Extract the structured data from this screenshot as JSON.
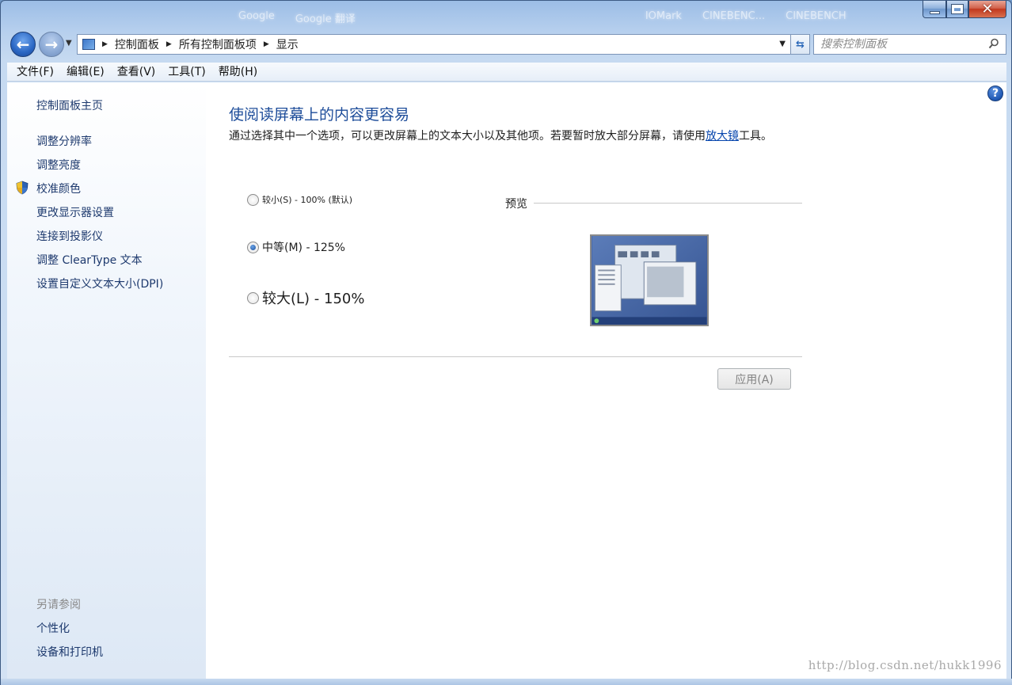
{
  "titlebar": {
    "ghost_tabs": [
      "Google",
      "Google 翻译",
      "IOMark",
      "CINEBENC...",
      "CINEBENCH"
    ]
  },
  "nav": {
    "breadcrumbs": [
      "控制面板",
      "所有控制面板项",
      "显示"
    ],
    "search_placeholder": "搜索控制面板"
  },
  "menu": {
    "items": [
      "文件(F)",
      "编辑(E)",
      "查看(V)",
      "工具(T)",
      "帮助(H)"
    ]
  },
  "sidebar": {
    "home": "控制面板主页",
    "links": [
      "调整分辨率",
      "调整亮度",
      "校准颜色",
      "更改显示器设置",
      "连接到投影仪",
      "调整 ClearType 文本",
      "设置自定义文本大小(DPI)"
    ],
    "see_also_header": "另请参阅",
    "see_also": [
      "个性化",
      "设备和打印机"
    ]
  },
  "main": {
    "title": "使阅读屏幕上的内容更容易",
    "description_pre": "通过选择其中一个选项，可以更改屏幕上的文本大小以及其他项。若要暂时放大部分屏幕，请使用",
    "description_link": "放大镜",
    "description_post": "工具。",
    "options": [
      {
        "label": "较小(S) - 100% (默认)",
        "checked": false
      },
      {
        "label": "中等(M) - 125%",
        "checked": true
      },
      {
        "label": "较大(L) - 150%",
        "checked": false
      }
    ],
    "preview_label": "预览",
    "apply_label": "应用(A)"
  },
  "watermark": "http://blog.csdn.net/hukk1996",
  "colors": {
    "accent": "#1e4d9a",
    "link": "#0645ad",
    "sidebar_link": "#1e3a6e"
  }
}
